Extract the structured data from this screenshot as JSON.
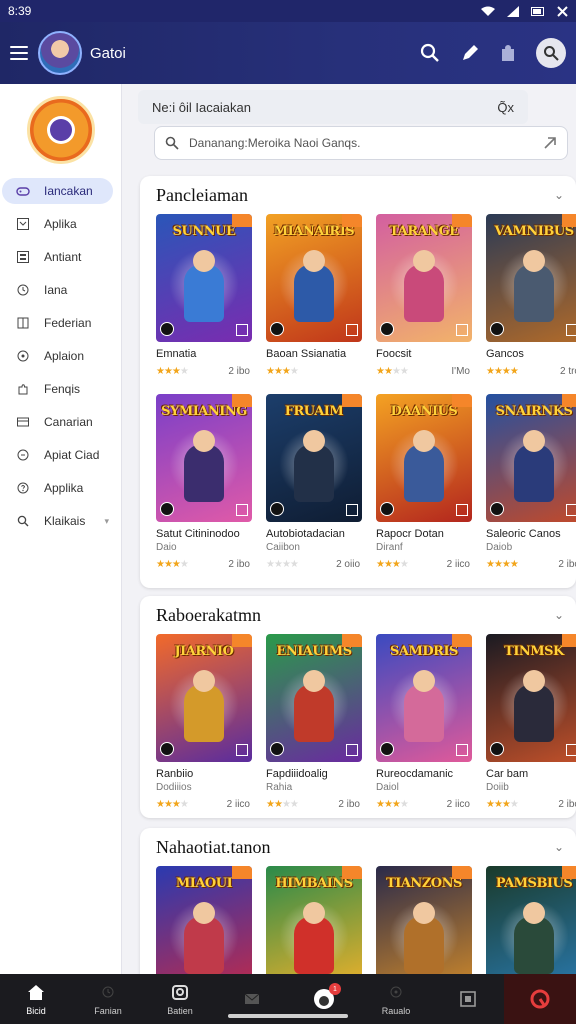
{
  "status": {
    "time": "8:39"
  },
  "appbar": {
    "title": "Gatoi"
  },
  "sidebar": {
    "items": [
      {
        "label": "Iancakan",
        "icon": "game-controller-icon",
        "active": true
      },
      {
        "label": "Aplika",
        "icon": "grid-icon"
      },
      {
        "label": "Antiant",
        "icon": "apps-icon"
      },
      {
        "label": "Iana",
        "icon": "clock-icon"
      },
      {
        "label": "Federian",
        "icon": "book-icon"
      },
      {
        "label": "Aplaion",
        "icon": "compass-icon"
      },
      {
        "label": "Fenqis",
        "icon": "puzzle-icon"
      },
      {
        "label": "Canarian",
        "icon": "card-icon"
      },
      {
        "label": "Apiat Ciad",
        "icon": "chat-icon"
      },
      {
        "label": "Applika",
        "icon": "help-icon"
      },
      {
        "label": "Klaikais",
        "icon": "search-icon",
        "caret": true
      }
    ]
  },
  "main": {
    "suggest": {
      "text": "Ne:i ôil Iacaiakan",
      "shortcut": "Q̃x"
    },
    "search": {
      "placeholder": "Dananang:Meroika Naoi Ganqs."
    },
    "sections": [
      {
        "title": "Pancleiaman",
        "rows": [
          [
            {
              "art_title": "SUNNUE",
              "name": "Emnatia",
              "sub": "",
              "stars": 3,
              "meta": "2 ibo",
              "c1": "#2a56b8",
              "c2": "#7a2cb0",
              "hero": "#3a7bd5"
            },
            {
              "art_title": "MIANAIRIS",
              "name": "Baoan Ssianatia",
              "sub": "",
              "stars": 3,
              "meta": "",
              "c1": "#f2a124",
              "c2": "#c0361a",
              "hero": "#2d5aa8"
            },
            {
              "art_title": "TARANGE",
              "name": "Foocsit",
              "sub": "",
              "stars": 2,
              "meta": "I'Mo",
              "c1": "#d35fa0",
              "c2": "#f2b36a",
              "hero": "#c94a7a"
            },
            {
              "art_title": "VAMNIBUS",
              "name": "Gancos",
              "sub": "",
              "stars": 4,
              "meta": "2 tro",
              "c1": "#2b3a55",
              "c2": "#b06a2a",
              "hero": "#4a5a70"
            }
          ],
          [
            {
              "art_title": "SYMIANING",
              "name": "Satut Citininodoo",
              "sub": "Daio",
              "stars": 3,
              "meta": "2 ibo",
              "c1": "#7a3fc8",
              "c2": "#e05aa8",
              "hero": "#3b2d6e"
            },
            {
              "art_title": "FRUAIM",
              "name": "Autobiotadacian",
              "sub": "Caiibon",
              "stars": 0,
              "meta": "2 oiio",
              "c1": "#1c3e6b",
              "c2": "#0f1d33",
              "hero": "#223048"
            },
            {
              "art_title": "DAANIUS",
              "name": "Rapocr Dotan",
              "sub": "Diranf",
              "stars": 3,
              "meta": "2 iico",
              "c1": "#f4a223",
              "c2": "#b3261e",
              "hero": "#3a5a9a"
            },
            {
              "art_title": "SNAIRNKS",
              "name": "Saleoric Canos",
              "sub": "Daiob",
              "stars": 4,
              "meta": "2 ibo",
              "c1": "#2450a0",
              "c2": "#c04a2c",
              "hero": "#2a3b7a"
            }
          ]
        ]
      },
      {
        "title": "Raboerakatmn",
        "rows": [
          [
            {
              "art_title": "JIARNIO",
              "name": "Ranbiio",
              "sub": "Dodiiios",
              "stars": 3,
              "meta": "2 iico",
              "c1": "#f26a2a",
              "c2": "#5a2c9e",
              "hero": "#d49a2a"
            },
            {
              "art_title": "ENIAUIMS",
              "name": "Fapdiiidoalig",
              "sub": "Rahia",
              "stars": 2,
              "meta": "2 ibo",
              "c1": "#2a9a4a",
              "c2": "#6a2aa0",
              "hero": "#c03a2a"
            },
            {
              "art_title": "SAMDRIS",
              "name": "Rureocdamanic",
              "sub": "Daiol",
              "stars": 3,
              "meta": "2 iico",
              "c1": "#3a4ac0",
              "c2": "#e05a9a",
              "hero": "#d46a9a"
            },
            {
              "art_title": "TINMSK",
              "name": "Car bam",
              "sub": "Doiib",
              "stars": 3,
              "meta": "2 ibo",
              "c1": "#1a1a22",
              "c2": "#c0502a",
              "hero": "#2a2a3a"
            }
          ]
        ]
      },
      {
        "title": "Nahaotiat.tanon",
        "rows": [
          [
            {
              "art_title": "MIAOUI",
              "name": "",
              "sub": "",
              "stars": 0,
              "meta": "",
              "c1": "#2a3ab0",
              "c2": "#c02a4a",
              "hero": "#c03a4a"
            },
            {
              "art_title": "HIMBAINS",
              "name": "",
              "sub": "",
              "stars": 0,
              "meta": "",
              "c1": "#2a8a4a",
              "c2": "#f2b22a",
              "hero": "#d0302a"
            },
            {
              "art_title": "TIANZONS",
              "name": "",
              "sub": "",
              "stars": 0,
              "meta": "",
              "c1": "#2a2a4a",
              "c2": "#d08a2a",
              "hero": "#b0702a"
            },
            {
              "art_title": "PAMSBIUS",
              "name": "",
              "sub": "",
              "stars": 0,
              "meta": "",
              "c1": "#1a3a2a",
              "c2": "#2a7ab0",
              "hero": "#2a4a3a"
            }
          ]
        ]
      }
    ]
  },
  "bottomnav": {
    "items": [
      {
        "label": "Bicid",
        "icon": "home-icon",
        "active": true
      },
      {
        "label": "Fanian",
        "icon": "clock-icon"
      },
      {
        "label": "Batien",
        "icon": "store-icon"
      },
      {
        "label": "",
        "icon": "mail-icon"
      },
      {
        "label": "",
        "icon": "profile-icon",
        "badge": "1"
      },
      {
        "label": "Raualo",
        "icon": "compass-icon"
      },
      {
        "label": "",
        "icon": "download-icon"
      },
      {
        "label": "",
        "icon": "alert-icon",
        "red": true
      }
    ]
  },
  "colors": {
    "appbar": "#20266a",
    "accent": "#f2a51b",
    "active_nav": "#dfe7fb"
  }
}
